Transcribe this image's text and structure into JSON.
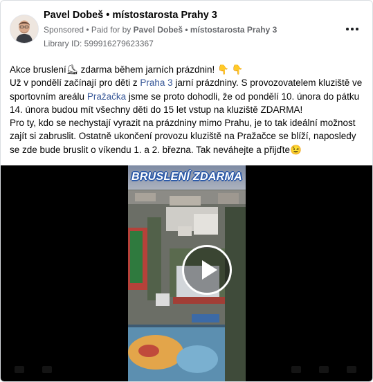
{
  "post": {
    "author": "Pavel Dobeš • místostarosta Prahy 3",
    "sponsored_label": "Sponsored",
    "paid_for_prefix": "• Paid for by",
    "paid_for_name": "Pavel Dobeš • místostarosta Prahy 3",
    "library_id": "Library ID: 599916279623367",
    "more_icon": "more-options-icon"
  },
  "text": {
    "line1": "Akce bruslení⛸ zdarma během jarních prázdnin! 👇 👇",
    "p2_a": "Už v pondělí začínají pro děti z ",
    "p2_link1": "Praha 3",
    "p2_b": " jarní prázdniny. S provozovatelem kluziště ve sportovním areálu ",
    "p2_link2": "Pražačka",
    "p2_c": " jsme se proto dohodli, že od pondělí 10. února do pátku 14. února budou mít všechny děti do 15 let vstup na kluziště ZDARMA!",
    "p3": "Pro ty, kdo se nechystají vyrazit na prázdniny mimo Prahu, je to tak ideální možnost zajít si zabruslit. Ostatně ukončení provozu kluziště na Pražačce se blíží, naposledy se zde bude bruslit o víkendu 1. a 2. března. Tak neváhejte a přijďte😉"
  },
  "video": {
    "title": "BRUSLENÍ ZDARMA",
    "play_icon": "play-icon"
  },
  "colors": {
    "link": "#385898",
    "secondary_text": "#65676b",
    "title_outline": "#2d5aa8"
  }
}
